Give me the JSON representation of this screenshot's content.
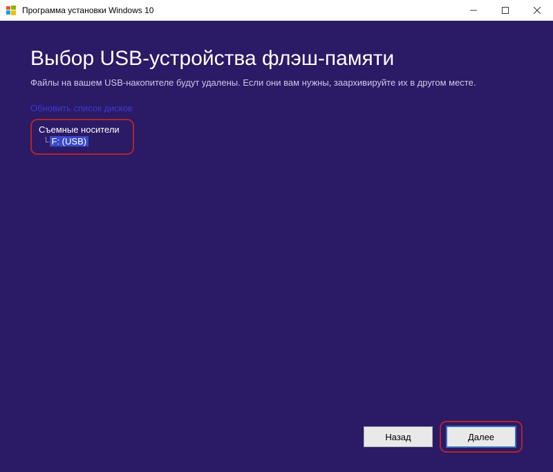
{
  "titlebar": {
    "title": "Программа установки Windows 10"
  },
  "main": {
    "heading": "Выбор USB-устройства флэш-памяти",
    "subtext": "Файлы на вашем USB-накопителе будут удалены. Если они вам нужны, заархивируйте их в другом месте.",
    "refresh_link": "Обновить список дисков",
    "tree": {
      "root_label": "Съемные носители",
      "selected_item": "F: (USB)"
    }
  },
  "footer": {
    "back_label": "Назад",
    "next_label": "Далее"
  }
}
